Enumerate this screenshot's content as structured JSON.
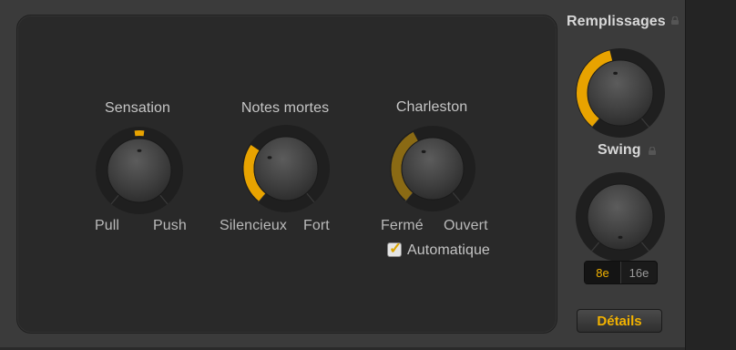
{
  "colors": {
    "accent": "#e8a300",
    "accent_dim": "#8a6a14",
    "panel": "#292929"
  },
  "main": {
    "sensation": {
      "title": "Sensation",
      "left": "Pull",
      "right": "Push",
      "value": 0.5
    },
    "notes_mortes": {
      "title": "Notes mortes",
      "left": "Silencieux",
      "right": "Fort",
      "value": 0.3
    },
    "charleston": {
      "title": "Charleston",
      "left": "Fermé",
      "right": "Ouvert",
      "value": 0.4,
      "disabled": true
    },
    "automatique": {
      "label": "Automatique",
      "checked": true
    }
  },
  "side": {
    "remplissages": {
      "title": "Remplissages",
      "value": 0.45,
      "locked_icon": "lock-icon"
    },
    "swing": {
      "title": "Swing",
      "value": 0.0,
      "locked_icon": "lock-icon"
    },
    "resolution": {
      "options": [
        "8e",
        "16e"
      ],
      "selected": "8e"
    },
    "details_label": "Détails"
  }
}
